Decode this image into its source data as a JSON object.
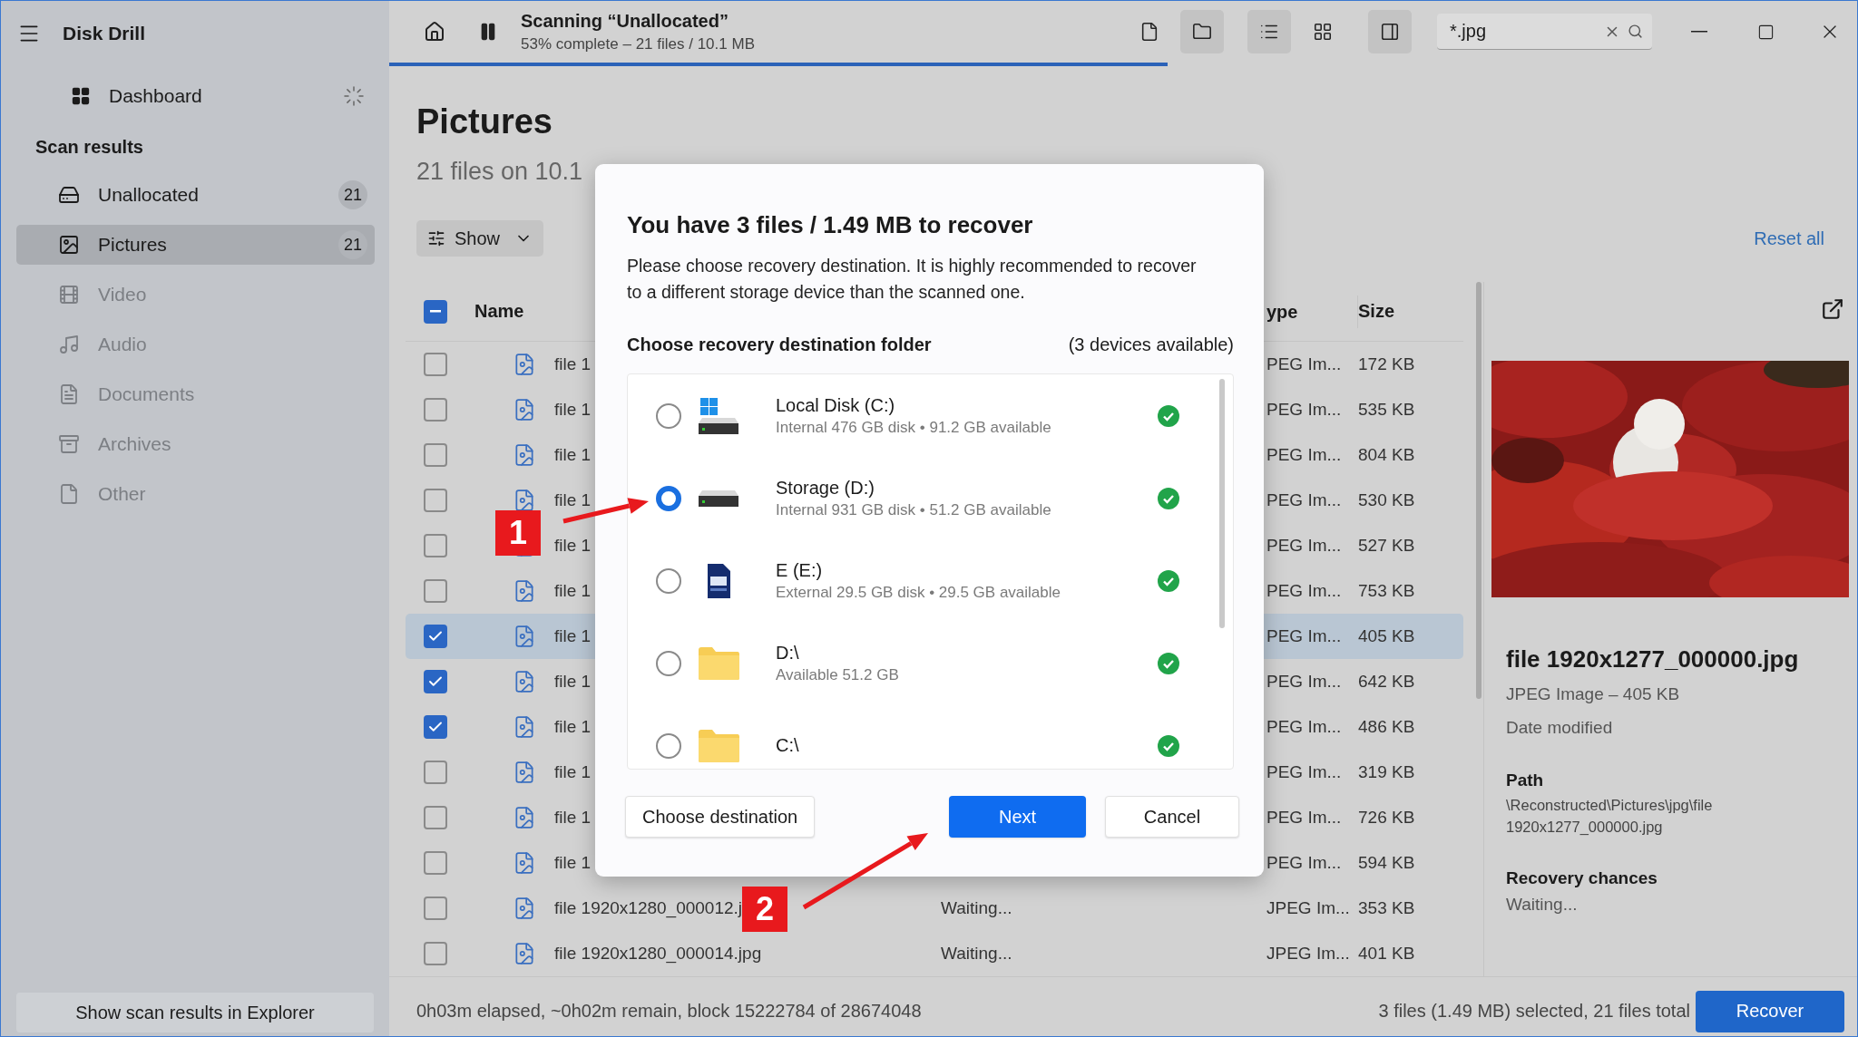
{
  "sidebar": {
    "app_title": "Disk Drill",
    "dashboard": "Dashboard",
    "section_title": "Scan results",
    "items": [
      {
        "kind": "disk",
        "label": "Unallocated",
        "count": "21",
        "selected": false,
        "disabled": false
      },
      {
        "kind": "pictures",
        "label": "Pictures",
        "count": "21",
        "selected": true,
        "disabled": false
      },
      {
        "kind": "video",
        "label": "Video",
        "selected": false,
        "disabled": true
      },
      {
        "kind": "audio",
        "label": "Audio",
        "selected": false,
        "disabled": true
      },
      {
        "kind": "documents",
        "label": "Documents",
        "selected": false,
        "disabled": true
      },
      {
        "kind": "archives",
        "label": "Archives",
        "selected": false,
        "disabled": true
      },
      {
        "kind": "other",
        "label": "Other",
        "selected": false,
        "disabled": true
      }
    ],
    "footer_button": "Show scan results in Explorer"
  },
  "toolbar": {
    "title": "Scanning “Unallocated”",
    "subtitle": "53% complete – 21 files / 10.1 MB",
    "progress": {
      "level": 0.53
    },
    "view_buttons": [
      {
        "kind": "file",
        "selected": false
      },
      {
        "kind": "folder",
        "selected": true
      },
      {
        "kind": "list",
        "selected": true
      },
      {
        "kind": "grid",
        "selected": false
      },
      {
        "kind": "panel",
        "selected": true
      }
    ],
    "search": {
      "value": "*.jpg"
    }
  },
  "content": {
    "title": "Pictures",
    "subtitle": "21 files on 10.1",
    "show_button": "Show",
    "reset_link": "Reset all"
  },
  "table": {
    "select_all_mixed": true,
    "columns": [
      {
        "kind": "name",
        "label": "Name"
      },
      {
        "kind": "type",
        "label": "ype"
      },
      {
        "kind": "size",
        "label": "Size"
      }
    ],
    "rows": [
      {
        "name": "file 1",
        "type": "PEG Im...",
        "size": "172 KB",
        "checked": false,
        "selected": false
      },
      {
        "name": "file 1",
        "type": "PEG Im...",
        "size": "535 KB",
        "checked": false,
        "selected": false
      },
      {
        "name": "file 1",
        "type": "PEG Im...",
        "size": "804 KB",
        "checked": false,
        "selected": false
      },
      {
        "name": "file 1",
        "type": "PEG Im...",
        "size": "530 KB",
        "checked": false,
        "selected": false
      },
      {
        "name": "file 1",
        "type": "PEG Im...",
        "size": "527 KB",
        "checked": false,
        "selected": false
      },
      {
        "name": "file 1",
        "type": "PEG Im...",
        "size": "753 KB",
        "checked": false,
        "selected": false
      },
      {
        "name": "file 1",
        "type": "PEG Im...",
        "size": "405 KB",
        "checked": true,
        "selected": true
      },
      {
        "name": "file 1",
        "type": "PEG Im...",
        "size": "642 KB",
        "checked": true,
        "selected": false
      },
      {
        "name": "file 1",
        "type": "PEG Im...",
        "size": "486 KB",
        "checked": true,
        "selected": false
      },
      {
        "name": "file 1",
        "type": "PEG Im...",
        "size": "319 KB",
        "checked": false,
        "selected": false
      },
      {
        "name": "file 1",
        "type": "PEG Im...",
        "size": "726 KB",
        "checked": false,
        "selected": false
      },
      {
        "name": "file 1",
        "type": "PEG Im...",
        "size": "594 KB",
        "checked": false,
        "selected": false
      },
      {
        "name": "file 1920x1280_000012.j",
        "status": "Waiting...",
        "type": "JPEG Im...",
        "size": "353 KB",
        "checked": false,
        "selected": false
      },
      {
        "name": "file 1920x1280_000014.jpg",
        "status": "Waiting...",
        "type": "JPEG Im...",
        "size": "401 KB",
        "checked": false,
        "selected": false
      }
    ]
  },
  "preview": {
    "filename": "file 1920x1277_000000.jpg",
    "meta": "JPEG Image – 405 KB",
    "date_label": "Date modified",
    "path_label": "Path",
    "path": "\\Reconstructed\\Pictures\\jpg\\file 1920x1277_000000.jpg",
    "chances_label": "Recovery chances",
    "chances": "Waiting..."
  },
  "footer": {
    "status": "0h03m elapsed, ~0h02m remain, block 15222784 of 28674048",
    "selection": "3 files (1.49 MB) selected, 21 files total",
    "recover_button": "Recover"
  },
  "dialog": {
    "title": "You have 3 files / 1.49 MB to recover",
    "message": "Please choose recovery destination. It is highly recommended to recover to a different storage device than the scanned one.",
    "list_title": "Choose recovery destination folder",
    "list_count": "(3 devices available)",
    "destinations": [
      {
        "kind": "system-disk",
        "name": "Local Disk (C:)",
        "detail": "Internal 476 GB disk • 91.2 GB available",
        "selected": false
      },
      {
        "kind": "disk",
        "name": "Storage (D:)",
        "detail": "Internal 931 GB disk • 51.2 GB available",
        "selected": true
      },
      {
        "kind": "sd-card",
        "name": "E (E:)",
        "detail": "External 29.5 GB disk • 29.5 GB available",
        "selected": false
      },
      {
        "kind": "folder",
        "name": "D:\\",
        "detail": "Available 51.2 GB",
        "selected": false
      },
      {
        "kind": "folder",
        "name": "C:\\",
        "selected": false
      }
    ],
    "buttons": [
      {
        "kind": "secondary",
        "label": "Choose destination"
      },
      {
        "kind": "primary",
        "label": "Next"
      },
      {
        "kind": "secondary",
        "label": "Cancel"
      }
    ]
  },
  "annotations": [
    {
      "label": "1"
    },
    {
      "label": "2"
    }
  ]
}
